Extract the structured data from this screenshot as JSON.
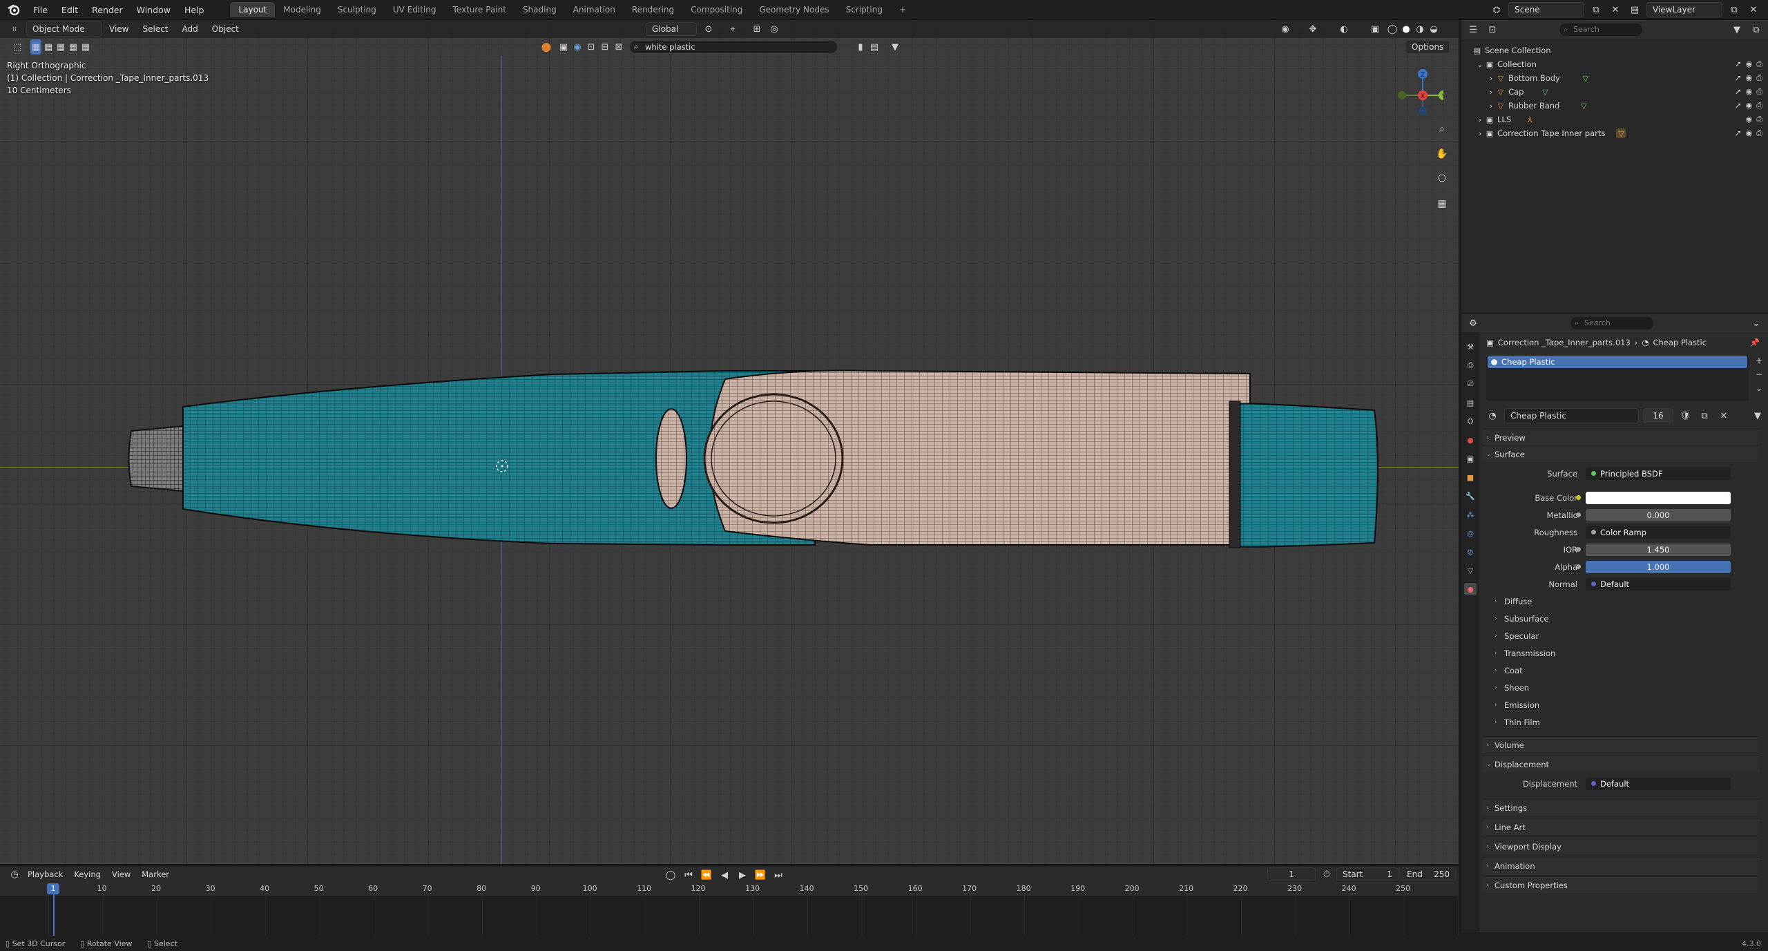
{
  "topbar": {
    "menus": [
      "File",
      "Edit",
      "Render",
      "Window",
      "Help"
    ],
    "workspaces": [
      "Layout",
      "Modeling",
      "Sculpting",
      "UV Editing",
      "Texture Paint",
      "Shading",
      "Animation",
      "Rendering",
      "Compositing",
      "Geometry Nodes",
      "Scripting"
    ],
    "add_workspace": "+",
    "scene": "Scene",
    "view_layer": "ViewLayer"
  },
  "viewport": {
    "mode": "Object Mode",
    "menus": [
      "View",
      "Select",
      "Add",
      "Object"
    ],
    "orientation": "Global",
    "material_search": "white plastic",
    "options": "Options",
    "info_view": "Right Orthographic",
    "info_collection": "(1) Collection | Correction _Tape_Inner_parts.013",
    "info_scale": "10 Centimeters",
    "gizmo": {
      "z": "Z",
      "y": "Y",
      "x": "X"
    }
  },
  "outliner": {
    "search_placeholder": "Search",
    "scene_collection": "Scene Collection",
    "collection": "Collection",
    "items": [
      {
        "name": "Bottom Body"
      },
      {
        "name": "Cap"
      },
      {
        "name": "Rubber Band"
      }
    ],
    "lls": "LLS",
    "inner_parts": "Correction Tape Inner parts"
  },
  "properties": {
    "search_placeholder": "Search",
    "object": "Correction _Tape_Inner_parts.013",
    "material": "Cheap Plastic",
    "slot": "Cheap Plastic",
    "material_field": "Cheap Plastic",
    "users": "16",
    "panels": {
      "preview": "Preview",
      "surface": "Surface",
      "volume": "Volume",
      "displacement": "Displacement",
      "settings": "Settings",
      "line_art": "Line Art",
      "viewport_display": "Viewport Display",
      "animation": "Animation",
      "custom_properties": "Custom Properties"
    },
    "surface_rows": [
      {
        "label": "Surface",
        "value": "Principled BSDF"
      },
      {
        "label": "Base Color",
        "value": ""
      },
      {
        "label": "Metallic",
        "value": "0.000"
      },
      {
        "label": "Roughness",
        "value": "Color Ramp"
      },
      {
        "label": "IOR",
        "value": "1.450"
      },
      {
        "label": "Alpha",
        "value": "1.000"
      },
      {
        "label": "Normal",
        "value": "Default"
      }
    ],
    "sub_panels": [
      "Diffuse",
      "Subsurface",
      "Specular",
      "Transmission",
      "Coat",
      "Sheen",
      "Emission",
      "Thin Film"
    ],
    "displacement_label": "Displacement",
    "displacement_value": "Default",
    "colors": {
      "accent": "#4772b3",
      "base_color": "#ffffff",
      "socket_yellow": "#c7c729",
      "socket_gray": "#a1a1a1",
      "socket_purple": "#6363c7",
      "socket_green": "#63c763"
    }
  },
  "timeline": {
    "menus": [
      "Playback",
      "Keying",
      "View",
      "Marker"
    ],
    "current_frame": "1",
    "start_label": "Start",
    "start": "1",
    "end_label": "End",
    "end": "250",
    "ticks": [
      "10",
      "20",
      "30",
      "40",
      "50",
      "60",
      "70",
      "80",
      "90",
      "100",
      "110",
      "120",
      "130",
      "140",
      "150",
      "160",
      "170",
      "180",
      "190",
      "200",
      "210",
      "220",
      "230",
      "240",
      "250"
    ],
    "cursor_label": "1"
  },
  "statusbar": {
    "items": [
      "Set 3D Cursor",
      "Rotate View",
      "Select"
    ],
    "version": "4.3.0"
  },
  "model_colors": {
    "teal": "#1f7d8a",
    "cream": "#c9b2a6",
    "wire": "#101010"
  }
}
